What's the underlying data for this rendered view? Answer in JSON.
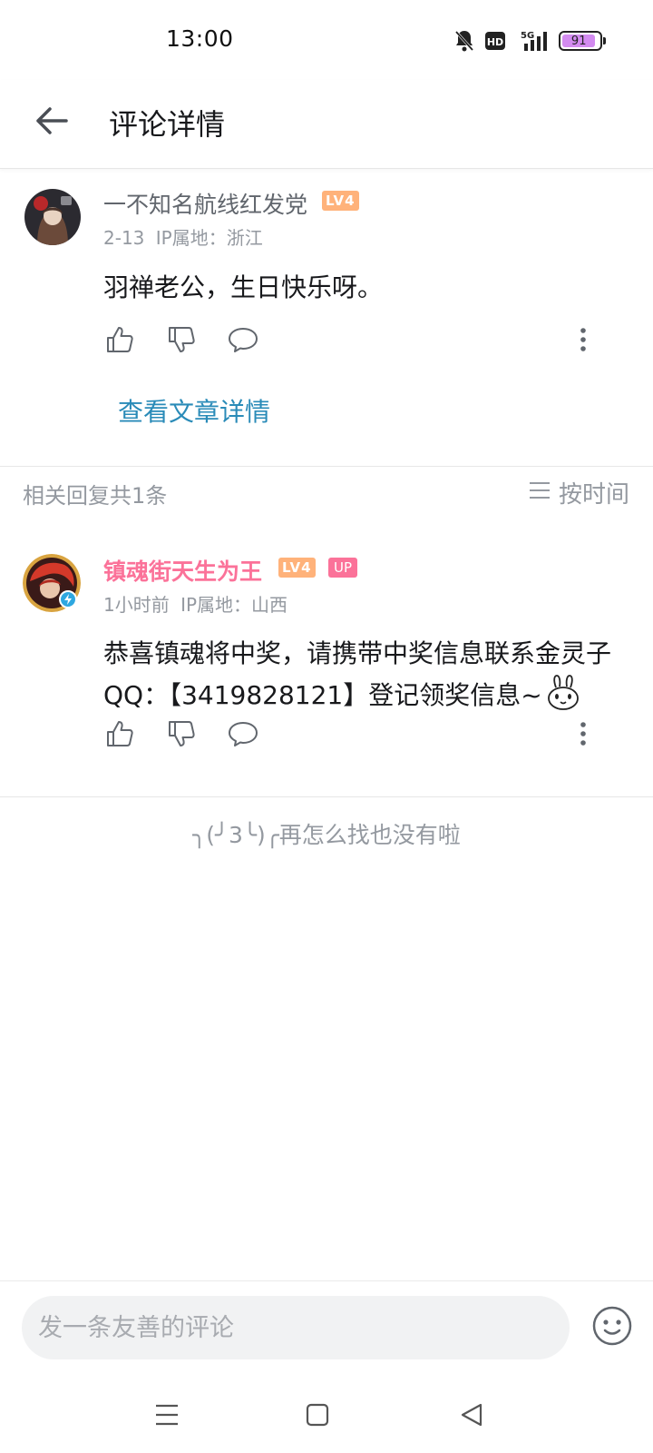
{
  "status_bar": {
    "time": "13:00",
    "network": "5G",
    "hd": "HD",
    "battery": "91",
    "battery_level_percent": 91
  },
  "header": {
    "title": "评论详情",
    "back_icon": "arrow-left-icon"
  },
  "main_comment": {
    "username": "一不知名航线红发党",
    "level": "LV4",
    "date": "2-13",
    "ip_location": "IP属地：浙江",
    "content": "羽禅老公，生日快乐呀。",
    "view_article": "查看文章详情"
  },
  "replies_header": {
    "count_label": "相关回复共1条",
    "sort_label": "按时间"
  },
  "reply": {
    "username": "镇魂街天生为王",
    "level": "LV4",
    "up_badge": "UP",
    "time": "1小时前",
    "ip_location": "IP属地：山西",
    "content": "恭喜镇魂将中奖，请携带中奖信息联系金灵子QQ：【3419828121】登记领奖信息~",
    "username_color": "#fb7299"
  },
  "end_message": "╮(╯3╰)╭再怎么找也没有啦",
  "comment_box": {
    "placeholder": "发一条友善的评论"
  },
  "colors": {
    "link": "#2a8bb8",
    "level_badge": "#ffb27a",
    "up_badge": "#fb7299",
    "meta_text": "#9499a0"
  }
}
